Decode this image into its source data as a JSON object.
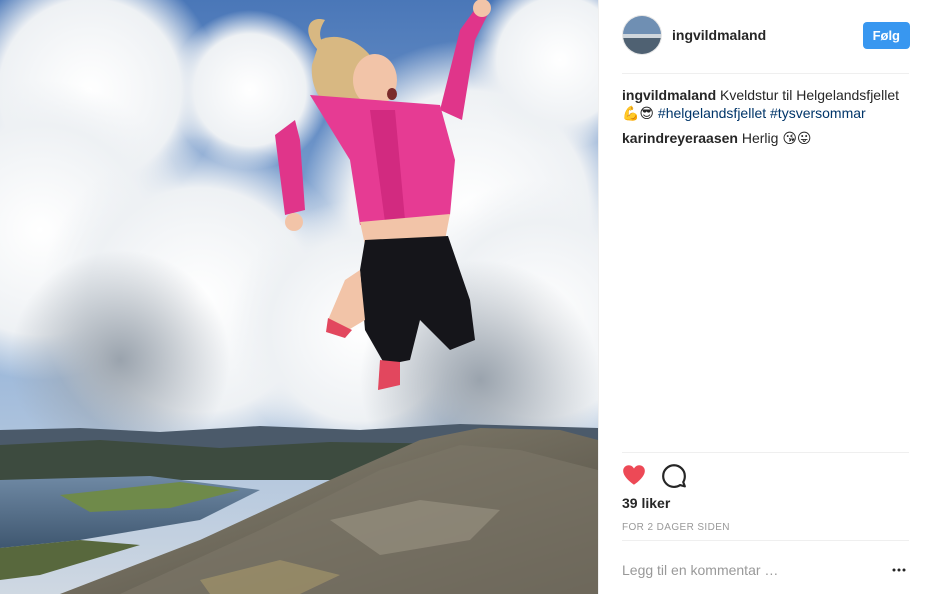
{
  "post": {
    "username": "ingvildmaland",
    "follow_label": "Følg",
    "likes": "39 liker",
    "timestamp": "FOR 2 DAGER SIDEN",
    "comment_placeholder": "Legg til en kommentar …"
  },
  "caption": {
    "author": "ingvildmaland",
    "text": "Kveldstur til Helgelandsfjellet",
    "emojis": "💪😎",
    "hashtags": [
      "#helgelandsfjellet",
      "#tysversommar"
    ]
  },
  "comments": [
    {
      "author": "karindreyeraasen",
      "text": "Herlig",
      "emojis": "😘😛"
    }
  ],
  "icons": {
    "like": "heart-icon",
    "comment": "comment-icon",
    "more": "more-options-icon"
  },
  "colors": {
    "accent": "#3897f0",
    "heart": "#ed4956",
    "hashtag": "#003569"
  }
}
